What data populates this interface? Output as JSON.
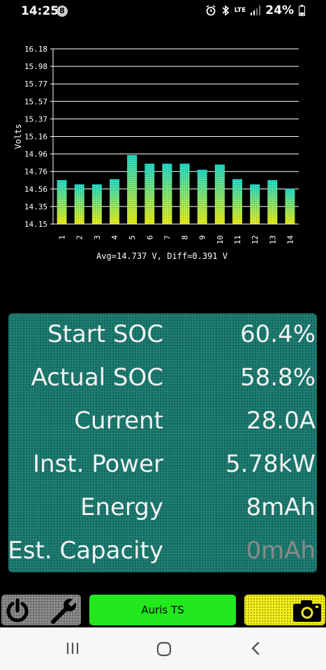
{
  "status_bar": {
    "time": "14:25",
    "notification_badge": "8",
    "network": "LTE",
    "battery": "24%",
    "icons": [
      "alarm-icon",
      "bluetooth-icon",
      "lte-icon",
      "signal-icon",
      "battery-icon"
    ]
  },
  "chart_data": {
    "type": "bar",
    "categories": [
      "1",
      "2",
      "3",
      "4",
      "5",
      "6",
      "7",
      "8",
      "9",
      "10",
      "11",
      "12",
      "13",
      "14"
    ],
    "values": [
      14.66,
      14.61,
      14.61,
      14.67,
      14.95,
      14.85,
      14.85,
      14.85,
      14.78,
      14.84,
      14.67,
      14.61,
      14.66,
      14.56
    ],
    "ylabel": "Volts",
    "y_ticks": [
      "16.18",
      "15.98",
      "15.77",
      "15.57",
      "15.37",
      "15.16",
      "14.96",
      "14.76",
      "14.56",
      "14.35",
      "14.15"
    ],
    "ylim": [
      14.15,
      16.18
    ],
    "caption": "Avg=14.737 V, Diff=0.391 V",
    "grid": true,
    "colors": {
      "bar_top": "#22dccb",
      "bar_bottom": "#eaf018",
      "grid": "#ffffff"
    }
  },
  "panel": {
    "rows": [
      {
        "label": "Start SOC",
        "value": "60.4%"
      },
      {
        "label": "Actual SOC",
        "value": "58.8%"
      },
      {
        "label": "Current",
        "value": "28.0A"
      },
      {
        "label": "Inst. Power",
        "value": "5.78kW"
      },
      {
        "label": "Energy",
        "value": "8mAh"
      },
      {
        "label": "Est. Capacity",
        "value": "0mAh"
      }
    ],
    "colors": {
      "background": "#1d7d72",
      "text": "#f2f2f2",
      "dim_text": "#8a8a8a"
    }
  },
  "controls": {
    "device_name": "Auris TS",
    "icons": [
      "power-icon",
      "wrench-icon",
      "camera-icon"
    ],
    "colors": {
      "settings": "#8a8a8a",
      "device": "#22e81e",
      "camera": "#f2ee1c"
    }
  },
  "nav": {
    "icons": [
      "recent-apps-icon",
      "home-icon",
      "back-icon"
    ]
  }
}
